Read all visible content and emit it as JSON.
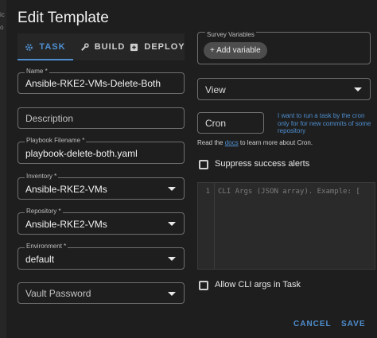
{
  "window": {
    "title": "Edit Template",
    "edge_marks": [
      "ic",
      "o"
    ]
  },
  "tabs": [
    {
      "label": "TASK",
      "icon": "gear-icon",
      "active": true
    },
    {
      "label": "BUILD",
      "icon": "wrench-icon",
      "active": false
    },
    {
      "label": "DEPLOY",
      "icon": "deploy-icon",
      "active": false
    }
  ],
  "form": {
    "name": {
      "label": "Name *",
      "value": "Ansible-RKE2-VMs-Delete-Both"
    },
    "description": {
      "placeholder": "Description"
    },
    "playbook": {
      "label": "Playbook Filename *",
      "value": "playbook-delete-both.yaml"
    },
    "inventory": {
      "label": "Inventory *",
      "value": "Ansible-RKE2-VMs"
    },
    "repository": {
      "label": "Repository *",
      "value": "Ansible-RKE2-VMs"
    },
    "environment": {
      "label": "Environment *",
      "value": "default"
    },
    "vault": {
      "placeholder": "Vault Password"
    }
  },
  "survey": {
    "label": "Survey Variables",
    "add_button": "+ Add variable"
  },
  "view_select": {
    "value": "View"
  },
  "cron": {
    "value": "Cron",
    "hint": "I want to run a task by the cron only for for new commits of some repository",
    "read_prefix": "Read the",
    "docs_link": "docs",
    "read_suffix": "to learn more about Cron."
  },
  "suppress_alerts": {
    "label": "Suppress success alerts",
    "checked": false
  },
  "cli_args": {
    "line_number": "1",
    "placeholder": "CLI Args (JSON array). Example: ["
  },
  "allow_cli": {
    "label": "Allow CLI args in Task",
    "checked": false
  },
  "actions": {
    "cancel": "CANCEL",
    "save": "SAVE"
  },
  "colors": {
    "accent": "#4f8fd0",
    "background": "#1e1e1e"
  }
}
